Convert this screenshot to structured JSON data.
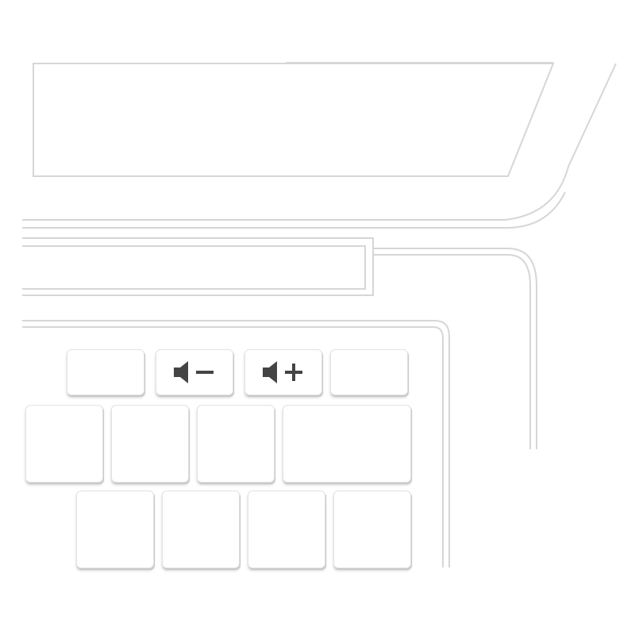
{
  "keyboard": {
    "function_row": [
      {
        "icon": "blank"
      },
      {
        "icon": "volume-down-icon"
      },
      {
        "icon": "volume-up-icon"
      },
      {
        "icon": "blank"
      }
    ],
    "number_row_count": 4,
    "letter_row_count": 4
  },
  "colors": {
    "icon": "#444444",
    "outline": "#d6d6d6",
    "key_border": "#e2e2e2"
  }
}
